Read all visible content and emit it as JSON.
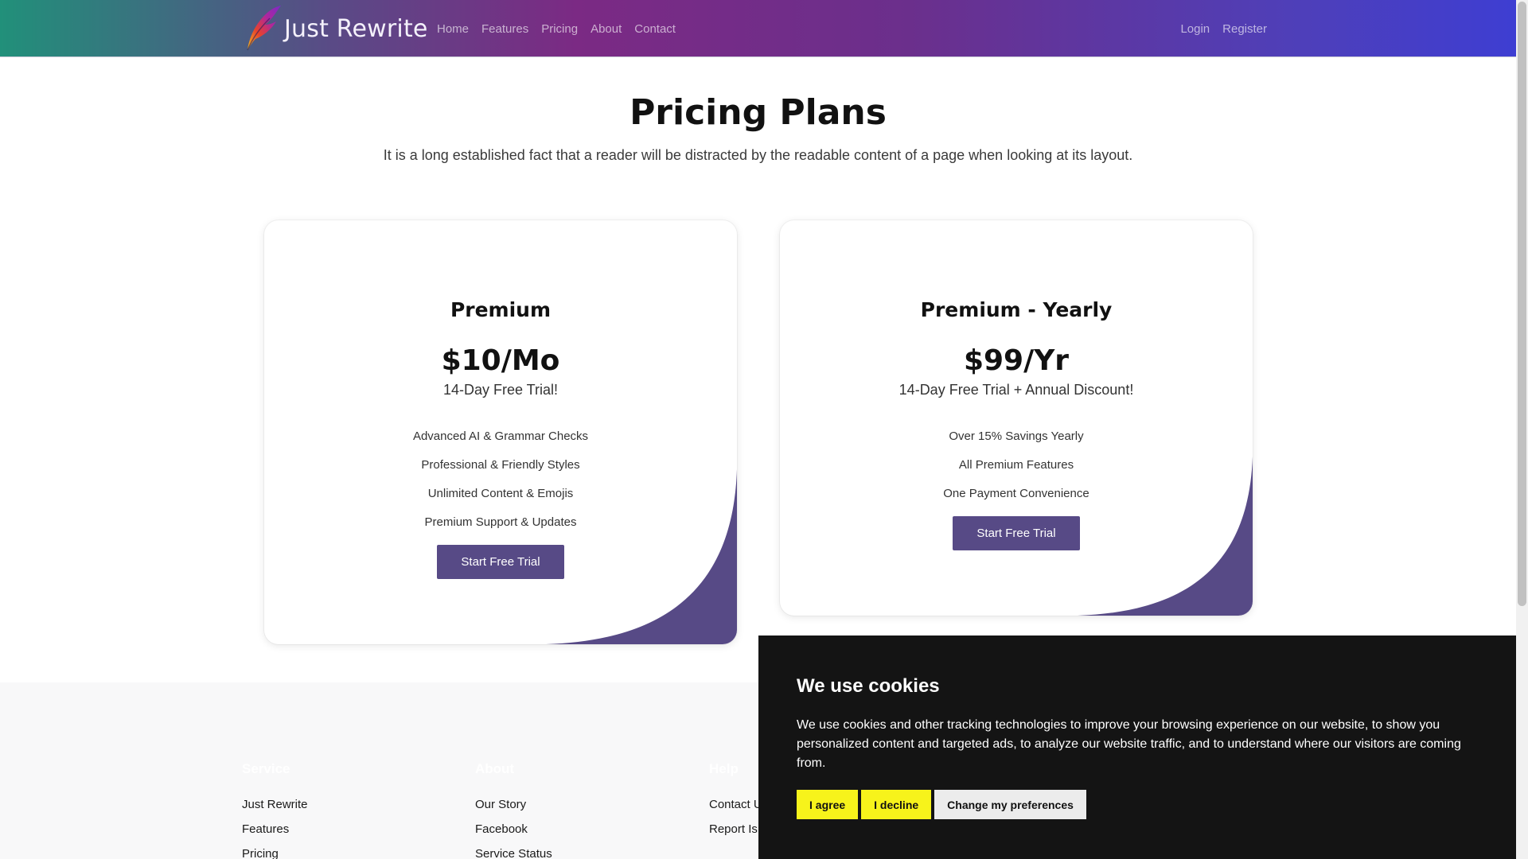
{
  "navbar": {
    "brand": "Just Rewrite",
    "links": [
      "Home",
      "Features",
      "Pricing",
      "About",
      "Contact"
    ],
    "login": "Login",
    "register": "Register"
  },
  "hero": {
    "title": "Pricing Plans",
    "subtitle": "It is a long established fact that a reader will be distracted by the readable content of a page when looking at its layout."
  },
  "plans": [
    {
      "name": "Premium",
      "price": "$10/Mo",
      "trial": "14-Day Free Trial!",
      "features": [
        "Advanced AI & Grammar Checks",
        "Professional & Friendly Styles",
        "Unlimited Content & Emojis",
        "Premium Support & Updates"
      ],
      "button": "Start Free Trial"
    },
    {
      "name": "Premium - Yearly",
      "price": "$99/Yr",
      "trial": "14-Day Free Trial + Annual Discount!",
      "features": [
        "Over 15% Savings Yearly",
        "All Premium Features",
        "One Payment Convenience"
      ],
      "button": "Start Free Trial"
    }
  ],
  "footer": {
    "columns": [
      {
        "heading": "Service",
        "links": [
          "Just Rewrite",
          "Features",
          "Pricing"
        ]
      },
      {
        "heading": "About",
        "links": [
          "Our Story",
          "Facebook",
          "Service Status"
        ]
      },
      {
        "heading": "Help",
        "links": [
          "Contact U",
          "Report Is"
        ]
      }
    ]
  },
  "cookie_banner": {
    "title": "We use cookies",
    "text": "We use cookies and other tracking technologies to improve your browsing experience on our website, to show you personalized content and targeted ads, to analyze our website traffic, and to understand where our visitors are coming from.",
    "agree": "I agree",
    "decline": "I decline",
    "preferences": "Change my preferences"
  },
  "colors": {
    "accent": "#574a86",
    "cookie_bg": "#141414",
    "cookie_button": "#f7f31b"
  },
  "icons": {
    "brand": "feather-logo-icon"
  }
}
